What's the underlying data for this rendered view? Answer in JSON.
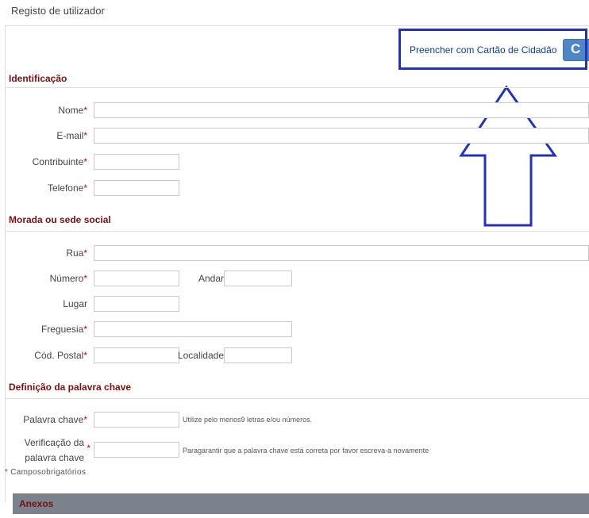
{
  "page": {
    "title": "Registo de utilizador"
  },
  "citizen_card": {
    "link_label": "Preencher com Cartão de Cidadão",
    "button_glyph": "C"
  },
  "sections": {
    "identificacao": "Identificação",
    "morada": "Morada ou sede social",
    "palavra": "Definição da palavra chave",
    "anexos": "Anexos"
  },
  "required_mark": "*",
  "fields": {
    "nome": {
      "label": "Nome",
      "value": ""
    },
    "email": {
      "label": "E-mail",
      "value": ""
    },
    "contribuinte": {
      "label": "Contribuinte",
      "value": ""
    },
    "telefone": {
      "label": "Telefone",
      "value": ""
    },
    "rua": {
      "label": "Rua",
      "value": ""
    },
    "numero": {
      "label": "Número",
      "value": ""
    },
    "andar": {
      "label": "Andar",
      "value": ""
    },
    "lugar": {
      "label": "Lugar",
      "value": ""
    },
    "freguesia": {
      "label": "Freguesia",
      "value": ""
    },
    "cod_postal": {
      "label": "Cód. Postal",
      "value": ""
    },
    "localidade": {
      "label": "Localidade",
      "value": ""
    },
    "palavra_chave": {
      "label": "Palavra chave",
      "value": "",
      "hint": "Utilize pelo menos9 letras e/ou números."
    },
    "verificacao": {
      "label_line1": "Verificação da",
      "label_line2": "palavra chave",
      "value": "",
      "hint": "Paragarantir que a palavra chave está correta por favor escreva-a novamente"
    }
  },
  "footer": {
    "mandatory_note": "* Camposobrigatórios"
  },
  "annotation": {
    "color": "#2432b8"
  }
}
